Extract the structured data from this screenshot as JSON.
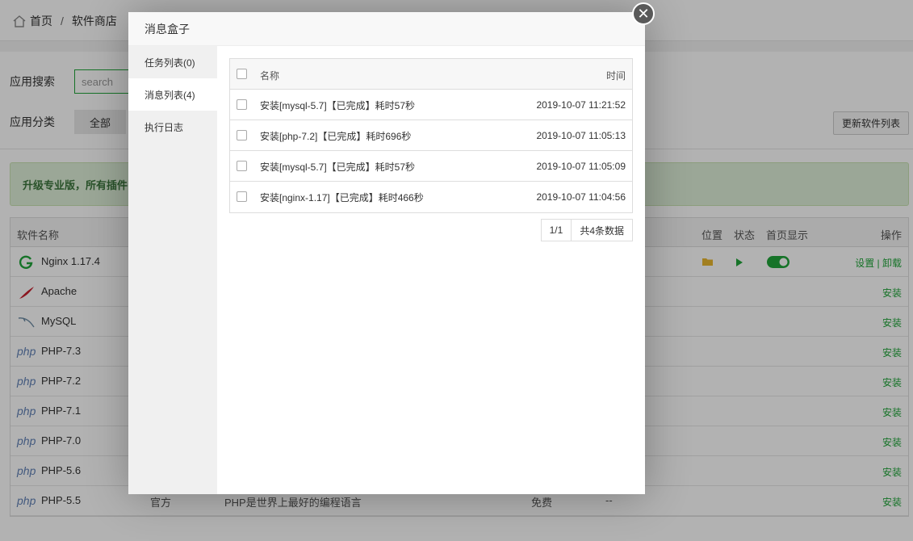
{
  "breadcrumb": {
    "home": "首页",
    "separator": "/",
    "current": "软件商店"
  },
  "search": {
    "label": "应用搜索",
    "placeholder": "search"
  },
  "category": {
    "label": "应用分类",
    "all": "全部"
  },
  "update_button": "更新软件列表",
  "promo_text": "升级专业版，所有插件，",
  "soft_table": {
    "headers": {
      "name": "软件名称",
      "location": "位置",
      "status": "状态",
      "home_display": "首页显示",
      "action": "操作"
    },
    "rows": [
      {
        "name": "Nginx 1.17.4",
        "icon": "nginx-icon",
        "action": "设置 | 卸载"
      },
      {
        "name": "Apache",
        "icon": "apache-feather-icon",
        "action": "安装"
      },
      {
        "name": "MySQL",
        "icon": "mysql-dolphin-icon",
        "action": "安装"
      },
      {
        "name": "PHP-7.3",
        "icon": "php-icon",
        "action": "安装"
      },
      {
        "name": "PHP-7.2",
        "icon": "php-icon",
        "action": "安装"
      },
      {
        "name": "PHP-7.1",
        "icon": "php-icon",
        "action": "安装"
      },
      {
        "name": "PHP-7.0",
        "icon": "php-icon",
        "action": "安装"
      },
      {
        "name": "PHP-5.6",
        "icon": "php-icon",
        "action": "安装"
      },
      {
        "name": "PHP-5.5",
        "icon": "php-icon",
        "action": "安装",
        "type": "官方",
        "desc": "PHP是世界上最好的编程语言",
        "price": "免费",
        "expire": "--"
      }
    ],
    "php_logo_text": "php"
  },
  "modal": {
    "title": "消息盒子",
    "close_glyph": "✕",
    "tabs": [
      "任务列表(0)",
      "消息列表(4)",
      "执行日志"
    ],
    "active_tab": 1,
    "table": {
      "headers": {
        "name": "名称",
        "time": "时间"
      },
      "rows": [
        {
          "name": "安装[mysql-5.7]【已完成】耗时57秒",
          "time": "2019-10-07 11:21:52"
        },
        {
          "name": "安装[php-7.2]【已完成】耗时696秒",
          "time": "2019-10-07 11:05:13"
        },
        {
          "name": "安装[mysql-5.7]【已完成】耗时57秒",
          "time": "2019-10-07 11:05:09"
        },
        {
          "name": "安装[nginx-1.17]【已完成】耗时466秒",
          "time": "2019-10-07 11:04:56"
        }
      ]
    },
    "pager": {
      "page": "1/1",
      "total": "共4条数据"
    }
  },
  "colors": {
    "accent": "#20a53a",
    "promo_bg": "#dff0d8",
    "php": "#6181b6"
  }
}
